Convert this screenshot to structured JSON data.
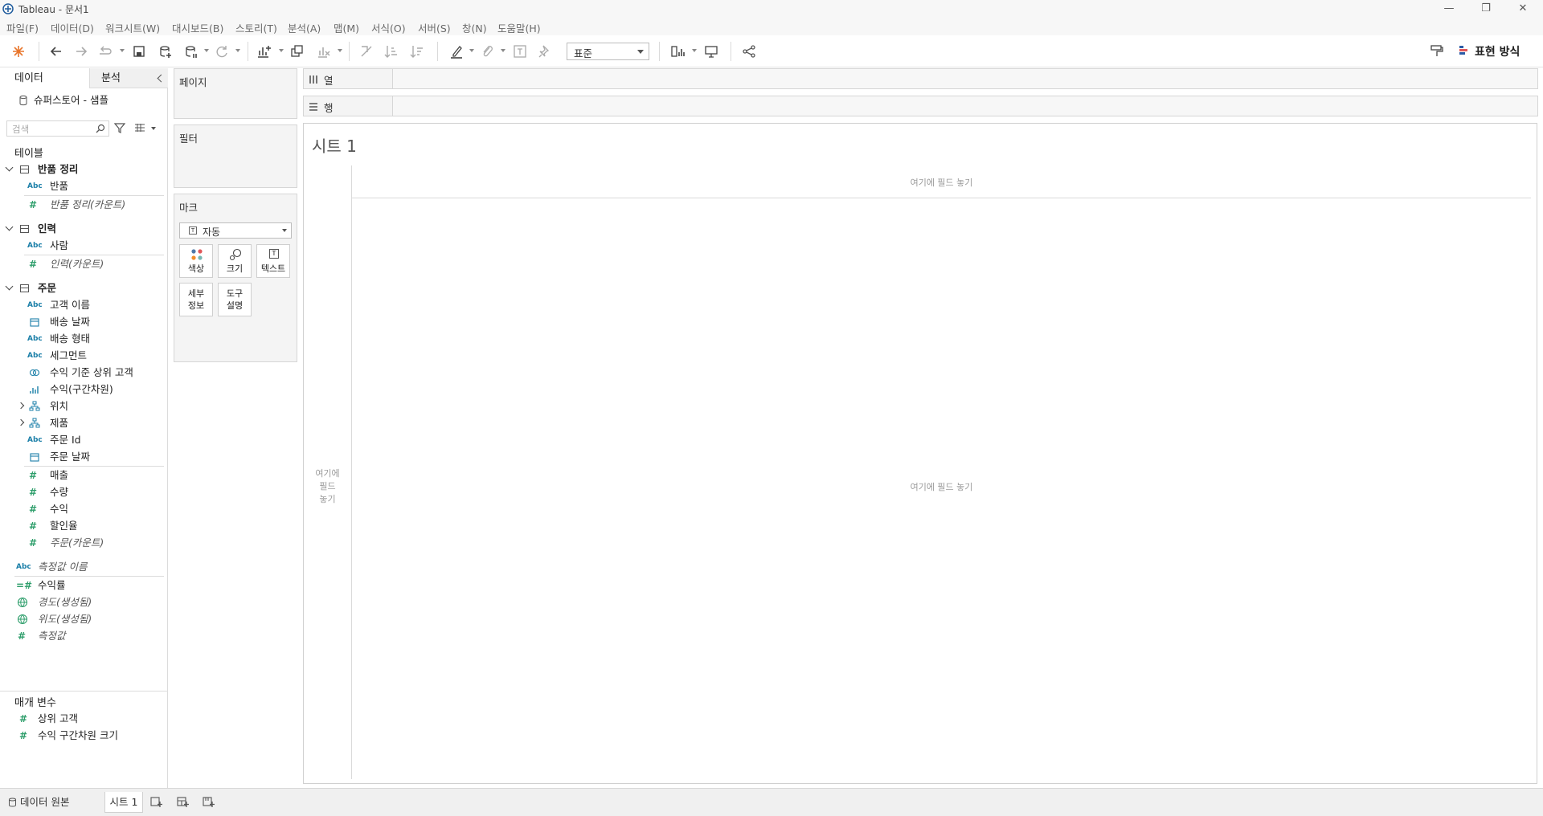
{
  "window": {
    "title": "Tableau - 문서1",
    "controls": {
      "minimize": "—",
      "restore": "❐",
      "close": "✕"
    }
  },
  "menu": [
    "파일(F)",
    "데이터(D)",
    "워크시트(W)",
    "대시보드(B)",
    "스토리(T)",
    "분석(A)",
    "맵(M)",
    "서식(O)",
    "서버(S)",
    "창(N)",
    "도움말(H)"
  ],
  "toolbar": {
    "fit_value": "표준",
    "show_me_label": "표현 방식"
  },
  "left_panel": {
    "tab_data": "데이터",
    "tab_analysis": "분석",
    "datasource": "슈퍼스토어 - 샘플",
    "search_placeholder": "검색",
    "tables_header": "테이블",
    "groups": [
      {
        "name": "반품 정리",
        "fields": [
          {
            "type": "Abc",
            "name": "반품"
          },
          {
            "type": "#",
            "name": "반품 정리(카운트)"
          }
        ]
      },
      {
        "name": "인력",
        "fields": [
          {
            "type": "Abc",
            "name": "사람"
          },
          {
            "type": "#",
            "name": "인력(카운트)"
          }
        ]
      },
      {
        "name": "주문",
        "fields": [
          {
            "type": "Abc",
            "name": "고객 이름"
          },
          {
            "type": "date",
            "name": "배송 날짜"
          },
          {
            "type": "Abc",
            "name": "배송 형태"
          },
          {
            "type": "Abc",
            "name": "세그먼트"
          },
          {
            "type": "set",
            "name": "수익 기준 상위 고객"
          },
          {
            "type": "bin",
            "name": "수익(구간차원)"
          },
          {
            "type": "hier",
            "name": "위치"
          },
          {
            "type": "hier",
            "name": "제품"
          },
          {
            "type": "Abc",
            "name": "주문 Id"
          },
          {
            "type": "date",
            "name": "주문 날짜"
          },
          {
            "type": "#",
            "name": "매출"
          },
          {
            "type": "#",
            "name": "수량"
          },
          {
            "type": "#",
            "name": "수익"
          },
          {
            "type": "#",
            "name": "할인율"
          },
          {
            "type": "#",
            "name": "주문(카운트)"
          }
        ]
      }
    ],
    "extra_fields": [
      {
        "type": "Abc",
        "name": "측정값 이름"
      },
      {
        "type": "calc",
        "name": "수익률"
      },
      {
        "type": "geo",
        "name": "경도(생성됨)"
      },
      {
        "type": "geo",
        "name": "위도(생성됨)"
      },
      {
        "type": "#",
        "name": "측정값"
      }
    ],
    "params_header": "매개 변수",
    "params": [
      {
        "type": "#",
        "name": "상위 고객"
      },
      {
        "type": "#",
        "name": "수익 구간차원 크기"
      }
    ]
  },
  "cards": {
    "pages": "페이지",
    "filters": "필터",
    "marks": "마크",
    "mark_type": "자동",
    "mark_buttons": {
      "color": "색상",
      "size": "크기",
      "text": "텍스트",
      "detail_1": "세부",
      "detail_2": "정보",
      "tooltip_1": "도구",
      "tooltip_2": "설명"
    }
  },
  "shelves": {
    "columns": "열",
    "rows": "행"
  },
  "sheet": {
    "title": "시트 1",
    "drop_top": "여기에 필드 놓기",
    "drop_left_1": "여기에",
    "drop_left_2": "필드",
    "drop_left_3": "놓기",
    "drop_center": "여기에 필드 놓기"
  },
  "bottom": {
    "datasource_tab": "데이터 원본",
    "sheet_tab": "시트 1"
  }
}
